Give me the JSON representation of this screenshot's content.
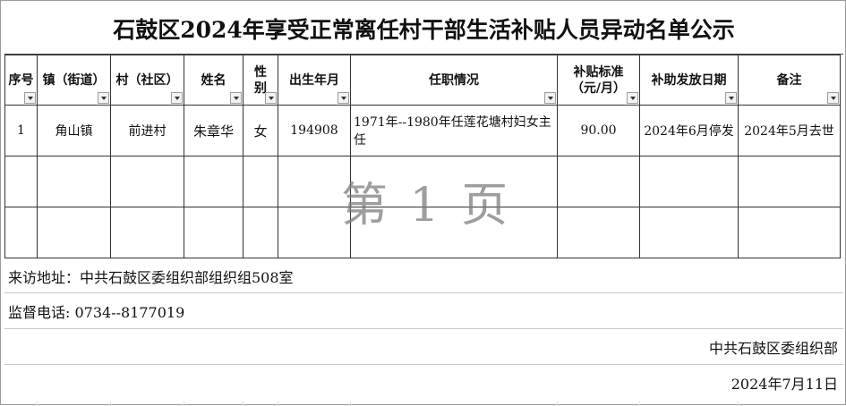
{
  "title": "石鼓区2024年享受正常离任村干部生活补贴人员异动名单公示",
  "columns": [
    {
      "key": "seq",
      "label_lines": [
        "序号"
      ]
    },
    {
      "key": "town",
      "label_lines": [
        "镇（街道）"
      ]
    },
    {
      "key": "village",
      "label_lines": [
        "村（社区）"
      ]
    },
    {
      "key": "name",
      "label_lines": [
        "姓名"
      ]
    },
    {
      "key": "gender",
      "label_lines": [
        "性",
        "别"
      ]
    },
    {
      "key": "birth",
      "label_lines": [
        "出生年月"
      ]
    },
    {
      "key": "position",
      "label_lines": [
        "任职情况"
      ]
    },
    {
      "key": "subsidy",
      "label_lines": [
        "补贴标准",
        "（元/月）"
      ]
    },
    {
      "key": "date",
      "label_lines": [
        "补助发放日期"
      ]
    },
    {
      "key": "remark",
      "label_lines": [
        "备注"
      ]
    }
  ],
  "rows": [
    {
      "seq": "1",
      "town": "角山镇",
      "village": "前进村",
      "name": "朱章华",
      "gender": "女",
      "birth": "194908",
      "position": "1971年--1980年任莲花塘村妇女主任",
      "subsidy": "90.00",
      "date": "2024年6月停发",
      "remark": "2024年5月去世"
    },
    {
      "seq": "",
      "town": "",
      "village": "",
      "name": "",
      "gender": "",
      "birth": "",
      "position": "",
      "subsidy": "",
      "date": "",
      "remark": ""
    },
    {
      "seq": "",
      "town": "",
      "village": "",
      "name": "",
      "gender": "",
      "birth": "",
      "position": "",
      "subsidy": "",
      "date": "",
      "remark": ""
    }
  ],
  "watermark": "第 1 页",
  "address": "来访地址：中共石鼓区委组织部组织组508室",
  "phone": "监督电话: 0734--8177019",
  "issuer": "中共石鼓区委组织部",
  "issue_date": "2024年7月11日"
}
